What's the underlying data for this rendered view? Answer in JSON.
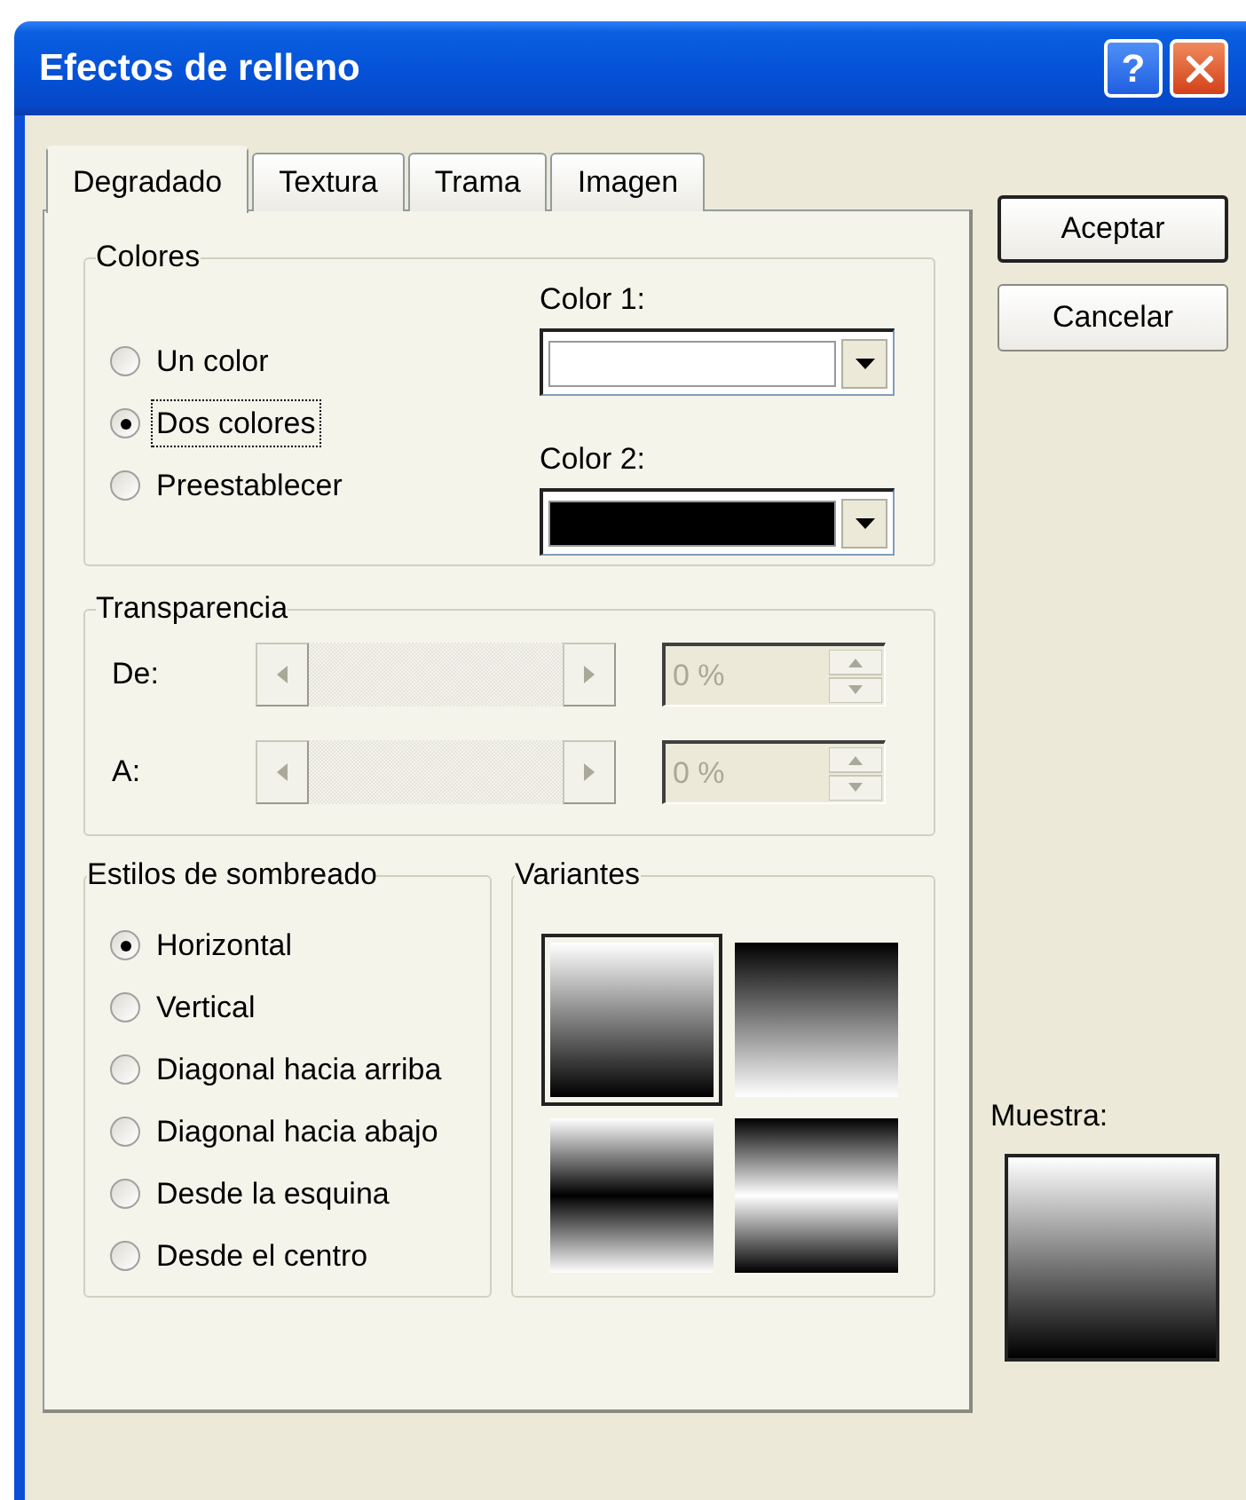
{
  "window": {
    "title": "Efectos de relleno"
  },
  "title_buttons": [
    {
      "kind": "help",
      "label": "?"
    },
    {
      "kind": "close"
    }
  ],
  "tabs": [
    {
      "label": "Degradado",
      "selected": true
    },
    {
      "label": "Textura",
      "selected": false
    },
    {
      "label": "Trama",
      "selected": false
    },
    {
      "label": "Imagen",
      "selected": false
    }
  ],
  "colores": {
    "title": "Colores",
    "options": [
      {
        "label": "Un color",
        "selected": false,
        "focused": false
      },
      {
        "label": "Dos colores",
        "selected": true,
        "focused": true
      },
      {
        "label": "Preestablecer",
        "selected": false,
        "focused": false
      }
    ],
    "color_1": {
      "label": "Color 1:",
      "color": "#ffffff"
    },
    "color_2": {
      "label": "Color 2:",
      "color": "#000000"
    }
  },
  "transparencia": {
    "title": "Transparencia",
    "disabled": true,
    "rows": [
      {
        "label": "De:",
        "value": "0 %"
      },
      {
        "label": "A:",
        "value": "0 %"
      }
    ]
  },
  "estilos": {
    "title": "Estilos de sombreado",
    "options": [
      {
        "label": "Horizontal",
        "selected": true
      },
      {
        "label": "Vertical",
        "selected": false
      },
      {
        "label": "Diagonal hacia arriba",
        "selected": false
      },
      {
        "label": "Diagonal hacia abajo",
        "selected": false
      },
      {
        "label": "Desde la esquina",
        "selected": false
      },
      {
        "label": "Desde el centro",
        "selected": false
      }
    ]
  },
  "variantes": {
    "title": "Variantes",
    "items": [
      {
        "kind": "light-to-dark",
        "selected": true
      },
      {
        "kind": "dark-to-light",
        "selected": false
      },
      {
        "kind": "light-dark-light",
        "selected": false
      },
      {
        "kind": "dark-light-dark",
        "selected": false
      }
    ]
  },
  "buttons": [
    {
      "label": "Aceptar",
      "default": true
    },
    {
      "label": "Cancelar",
      "default": false
    }
  ],
  "muestra": {
    "label": "Muestra:"
  }
}
